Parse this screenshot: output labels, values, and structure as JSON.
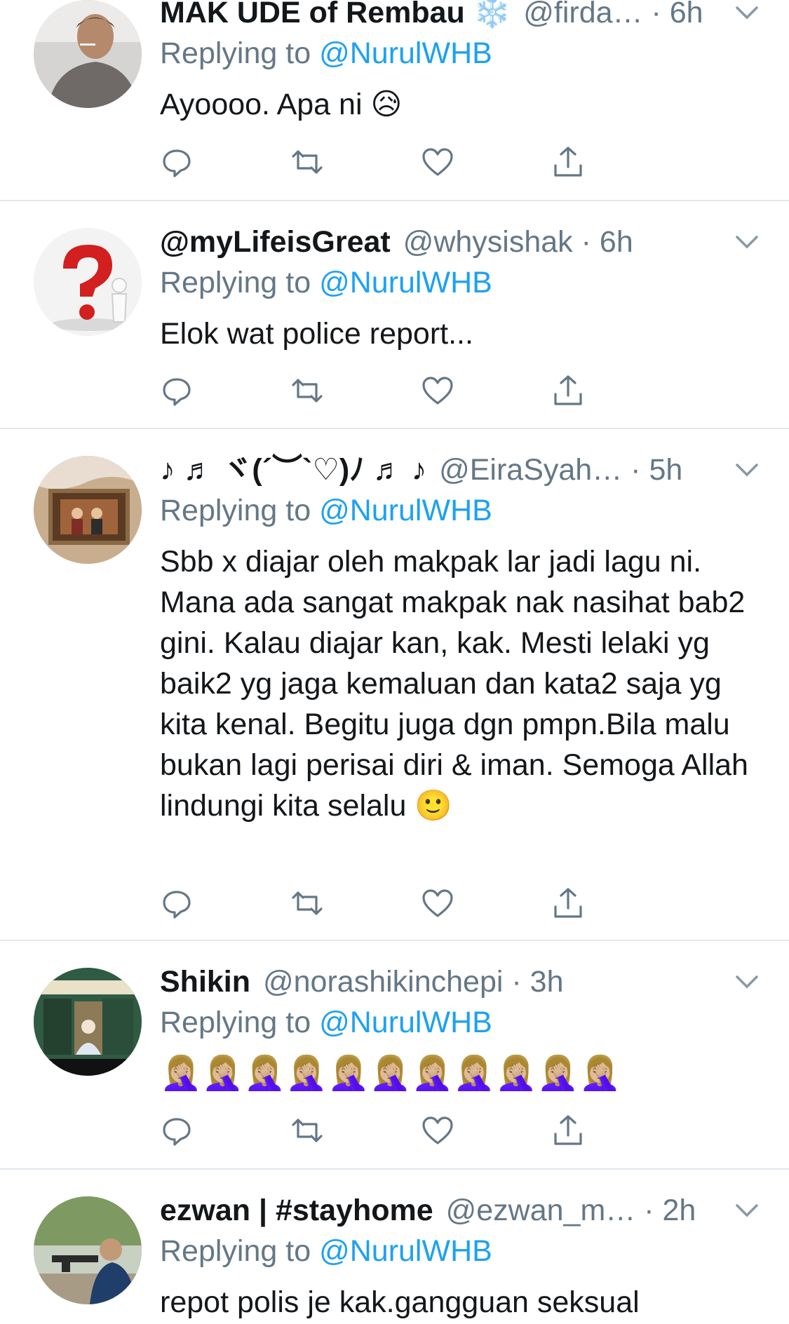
{
  "tweets": [
    {
      "display_name": "MAK UDE of Rembau ❄️",
      "handle": "@firda…",
      "dot": " · ",
      "time": "6h",
      "reply_prefix": "Replying to ",
      "reply_to": "@NurulWHB",
      "text": "Ayoooo. Apa ni 😥"
    },
    {
      "display_name": "@myLifeisGreat",
      "handle": "@whysishak",
      "dot": " · ",
      "time": "6h",
      "reply_prefix": "Replying to ",
      "reply_to": "@NurulWHB",
      "text": "Elok wat police report..."
    },
    {
      "display_name": "♪ ♬ ヾ(´︶`♡)ﾉ ♬ ♪",
      "handle": "@EiraSyah…",
      "dot": " · ",
      "time": "5h",
      "reply_prefix": "Replying to ",
      "reply_to": "@NurulWHB",
      "text": "Sbb x diajar oleh makpak lar jadi lagu ni. Mana ada sangat makpak nak nasihat bab2 gini. Kalau diajar kan, kak. Mesti lelaki yg baik2 yg jaga kemaluan dan kata2 saja yg kita kenal. Begitu juga dgn pmpn.Bila malu bukan lagi perisai diri & iman. Semoga Allah lindungi kita selalu 🙂"
    },
    {
      "display_name": "Shikin",
      "handle": "@norashikinchepi",
      "dot": " · ",
      "time": "3h",
      "reply_prefix": "Replying to ",
      "reply_to": "@NurulWHB",
      "text": "🤦🏼‍♀️🤦🏼‍♀️🤦🏼‍♀️🤦🏼‍♀️🤦🏼‍♀️🤦🏼‍♀️🤦🏼‍♀️🤦🏼‍♀️🤦🏼‍♀️🤦🏼‍♀️🤦🏼‍♀️"
    },
    {
      "display_name": "ezwan | #stayhome",
      "handle": "@ezwan_m…",
      "dot": " · ",
      "time": "2h",
      "reply_prefix": "Replying to ",
      "reply_to": "@NurulWHB",
      "text": "repot polis je kak.gangguan seksual"
    }
  ],
  "actions": [
    "reply-icon",
    "retweet-icon",
    "like-icon",
    "share-icon"
  ],
  "colors": {
    "link": "#1da1f2",
    "secondary_text": "#657786",
    "primary_text": "#14171a",
    "divider": "#e1e8ed"
  }
}
